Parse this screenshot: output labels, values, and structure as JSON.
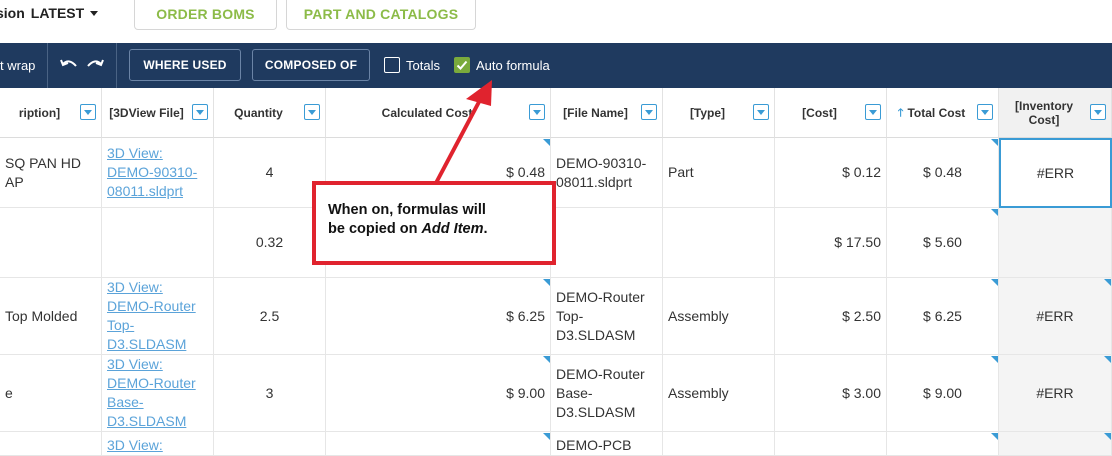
{
  "header": {
    "version_label": "sion",
    "version_value": "LATEST",
    "tabs": [
      {
        "label": "ORDER BOMS"
      },
      {
        "label": "PART AND CATALOGS"
      }
    ]
  },
  "toolbar": {
    "wrap_label": "t wrap",
    "where_used": "WHERE USED",
    "composed_of": "COMPOSED OF",
    "totals_label": "Totals",
    "totals_checked": false,
    "auto_formula_label": "Auto formula",
    "auto_formula_checked": true,
    "accent_color": "#7aaa3c",
    "bar_color": "#1f3a5f"
  },
  "columns": [
    {
      "label": "ription]"
    },
    {
      "label": "[3DView File]"
    },
    {
      "label": "Quantity"
    },
    {
      "label": "Calculated Cost"
    },
    {
      "label": "[File Name]"
    },
    {
      "label": "[Type]"
    },
    {
      "label": "[Cost]"
    },
    {
      "label": "Total Cost",
      "sorted": "asc"
    },
    {
      "label": "[Inventory Cost]"
    }
  ],
  "rows": [
    {
      "description": "SQ PAN HD AP",
      "view": "3D View: DEMO-90310-08011.sldprt",
      "quantity": "4",
      "calc_cost": "$ 0.48",
      "file_name": "DEMO-90310-08011.sldprt",
      "type": "Part",
      "cost": "$ 0.12",
      "total_cost": "$ 0.48",
      "inventory_cost": "#ERR"
    },
    {
      "description": "",
      "view": "",
      "quantity": "0.32",
      "calc_cost": "",
      "file_name": "",
      "type": "",
      "cost": "$ 17.50",
      "total_cost": "$ 5.60",
      "inventory_cost": ""
    },
    {
      "description": "Top Molded",
      "view": "3D View: DEMO-Router Top-D3.SLDASM",
      "quantity": "2.5",
      "calc_cost": "$ 6.25",
      "file_name": "DEMO-Router Top-D3.SLDASM",
      "type": "Assembly",
      "cost": "$ 2.50",
      "total_cost": "$ 6.25",
      "inventory_cost": "#ERR"
    },
    {
      "description": "e",
      "view": "3D View: DEMO-Router Base-D3.SLDASM",
      "quantity": "3",
      "calc_cost": "$ 9.00",
      "file_name": "DEMO-Router Base-D3.SLDASM",
      "type": "Assembly",
      "cost": "$ 3.00",
      "total_cost": "$ 9.00",
      "inventory_cost": "#ERR"
    },
    {
      "description": "",
      "view": "3D View:",
      "quantity": "",
      "calc_cost": "",
      "file_name": "DEMO-PCB",
      "type": "",
      "cost": "",
      "total_cost": "",
      "inventory_cost": ""
    }
  ],
  "callout": {
    "text_line1": "When on, formulas will",
    "text_line2_prefix": "be copied on ",
    "text_line2_em": "Add Item",
    "text_line2_suffix": "."
  }
}
